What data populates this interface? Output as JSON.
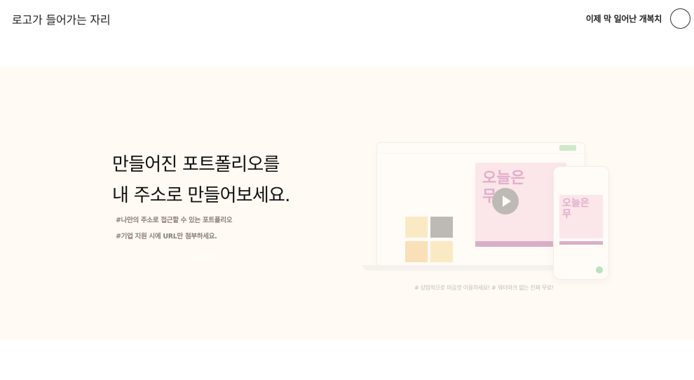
{
  "header": {
    "logo_text": "로고가 들어가는 자리",
    "user_name": "이제 막 일어난 개복치"
  },
  "hero": {
    "headline_line1": "만들어진 포트폴리오를",
    "headline_line2": "내 주소로 만들어보세요.",
    "sub_line1": "#나만의 주소로 접근할 수 있는 포트폴리오",
    "sub_line2": "#기업 지원 시에 URL만 첨부하세요.",
    "cta_label": "시작하기",
    "preview": {
      "poster_text": "오늘은\n무",
      "phone_poster_text": "오늘은\n무",
      "caption": "# 상업적으로 마음껏 이용하세요! # 워터마크 없는 진짜 무료!"
    }
  },
  "colors": {
    "hero_bg": "#fffaf3",
    "poster_pink": "#f7c7dc",
    "poster_accent": "#b5338a"
  }
}
